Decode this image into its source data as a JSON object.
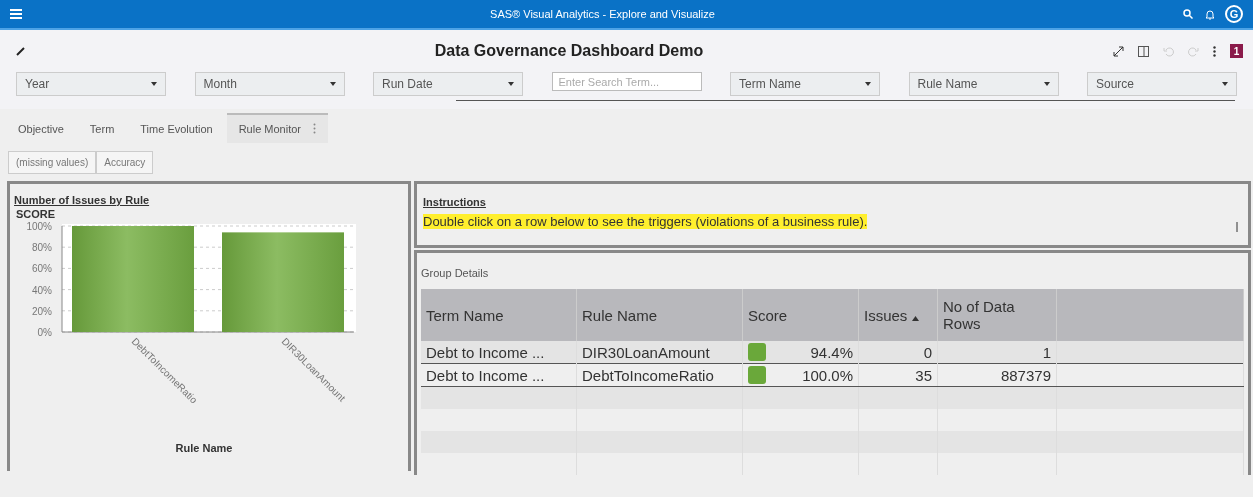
{
  "app_bar": {
    "title": "SAS® Visual Analytics - Explore and Visualize",
    "user_initial": "G"
  },
  "report": {
    "title": "Data Governance Dashboard Demo",
    "badge": "1"
  },
  "filters": [
    {
      "kind": "dropdown",
      "label": "Year"
    },
    {
      "kind": "dropdown",
      "label": "Month"
    },
    {
      "kind": "dropdown",
      "label": "Run Date"
    },
    {
      "kind": "search",
      "placeholder": "Enter Search Term..."
    },
    {
      "kind": "dropdown",
      "label": "Term Name"
    },
    {
      "kind": "dropdown",
      "label": "Rule Name"
    },
    {
      "kind": "dropdown",
      "label": "Source"
    }
  ],
  "tabs": [
    {
      "label": "Objective",
      "selected": false
    },
    {
      "label": "Term",
      "selected": false
    },
    {
      "label": "Time Evolution",
      "selected": false
    },
    {
      "label": "Rule Monitor",
      "selected": true
    }
  ],
  "sub_buttons": [
    "(missing values)",
    "Accuracy"
  ],
  "chart_panel": {
    "title": "Number of Issues by Rule",
    "chart_data": {
      "type": "bar",
      "ylabel": "SCORE",
      "xlabel": "Rule Name",
      "categories": [
        "DebtToIncomeRatio",
        "DIR30LoanAmount"
      ],
      "values": [
        100,
        94
      ],
      "grid": true,
      "ylim": [
        0,
        100
      ],
      "yticks": [
        {
          "value": 0,
          "label": "0%"
        },
        {
          "value": 20,
          "label": "20%"
        },
        {
          "value": 40,
          "label": "40%"
        },
        {
          "value": 60,
          "label": "60%"
        },
        {
          "value": 80,
          "label": "80%"
        },
        {
          "value": 100,
          "label": "100%"
        }
      ]
    }
  },
  "instructions": {
    "title": "Instructions",
    "text": "Double click on a row below to see the triggers (violations of a business rule)."
  },
  "table": {
    "title": "Group Details",
    "columns": [
      {
        "label": "Term Name",
        "sorted": false
      },
      {
        "label": "Rule Name",
        "sorted": false
      },
      {
        "label": "Score",
        "sorted": false
      },
      {
        "label": "Issues",
        "sorted": true
      },
      {
        "label": "No of Data Rows",
        "sorted": false
      }
    ],
    "rows": [
      {
        "term": "Debt to Income ...",
        "rule": "DIR30LoanAmount",
        "score": "94.4%",
        "color": "#6aa83a",
        "issues": "0",
        "data_rows": "1",
        "selected": false
      },
      {
        "term": "Debt to Income ...",
        "rule": "DebtToIncomeRatio",
        "score": "100.0%",
        "color": "#6aa83a",
        "issues": "35",
        "data_rows": "887379",
        "selected": true
      }
    ]
  }
}
